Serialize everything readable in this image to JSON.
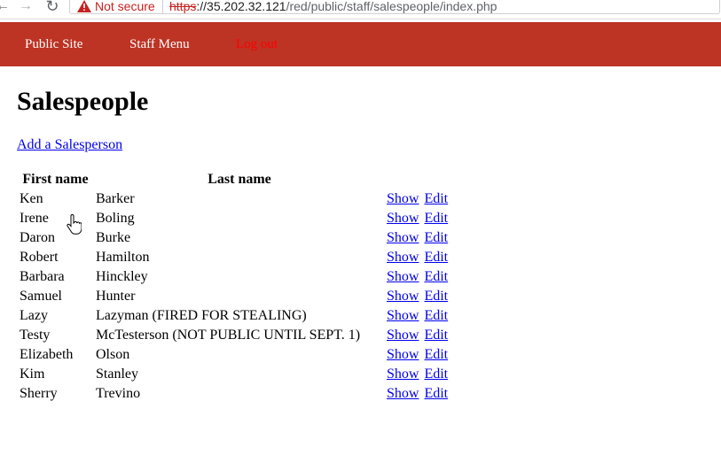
{
  "browser": {
    "security_label": "Not secure",
    "url_scheme": "https",
    "url_host": "://35.202.32.121",
    "url_path": "/red/public/staff/salespeople/index.php"
  },
  "nav": {
    "public_site": "Public Site",
    "staff_menu": "Staff Menu",
    "log_out": "Log out"
  },
  "page": {
    "title": "Salespeople",
    "add_link": "Add a Salesperson"
  },
  "table": {
    "headers": {
      "first": "First name",
      "last": "Last name"
    },
    "actions": {
      "show": "Show",
      "edit": "Edit"
    },
    "rows": [
      {
        "first": "Ken",
        "last": "Barker"
      },
      {
        "first": "Irene",
        "last": "Boling"
      },
      {
        "first": "Daron",
        "last": "Burke"
      },
      {
        "first": "Robert",
        "last": "Hamilton"
      },
      {
        "first": "Barbara",
        "last": "Hinckley"
      },
      {
        "first": "Samuel",
        "last": "Hunter"
      },
      {
        "first": "Lazy",
        "last": "Lazyman (FIRED FOR STEALING)"
      },
      {
        "first": "Testy",
        "last": "McTesterson (NOT PUBLIC UNTIL SEPT. 1)"
      },
      {
        "first": "Elizabeth",
        "last": "Olson"
      },
      {
        "first": "Kim",
        "last": "Stanley"
      },
      {
        "first": "Sherry",
        "last": "Trevino"
      }
    ]
  },
  "colors": {
    "header_bg": "#bd3324",
    "link": "#0000ee",
    "logout": "#ff0000",
    "warning": "#c5221f"
  }
}
